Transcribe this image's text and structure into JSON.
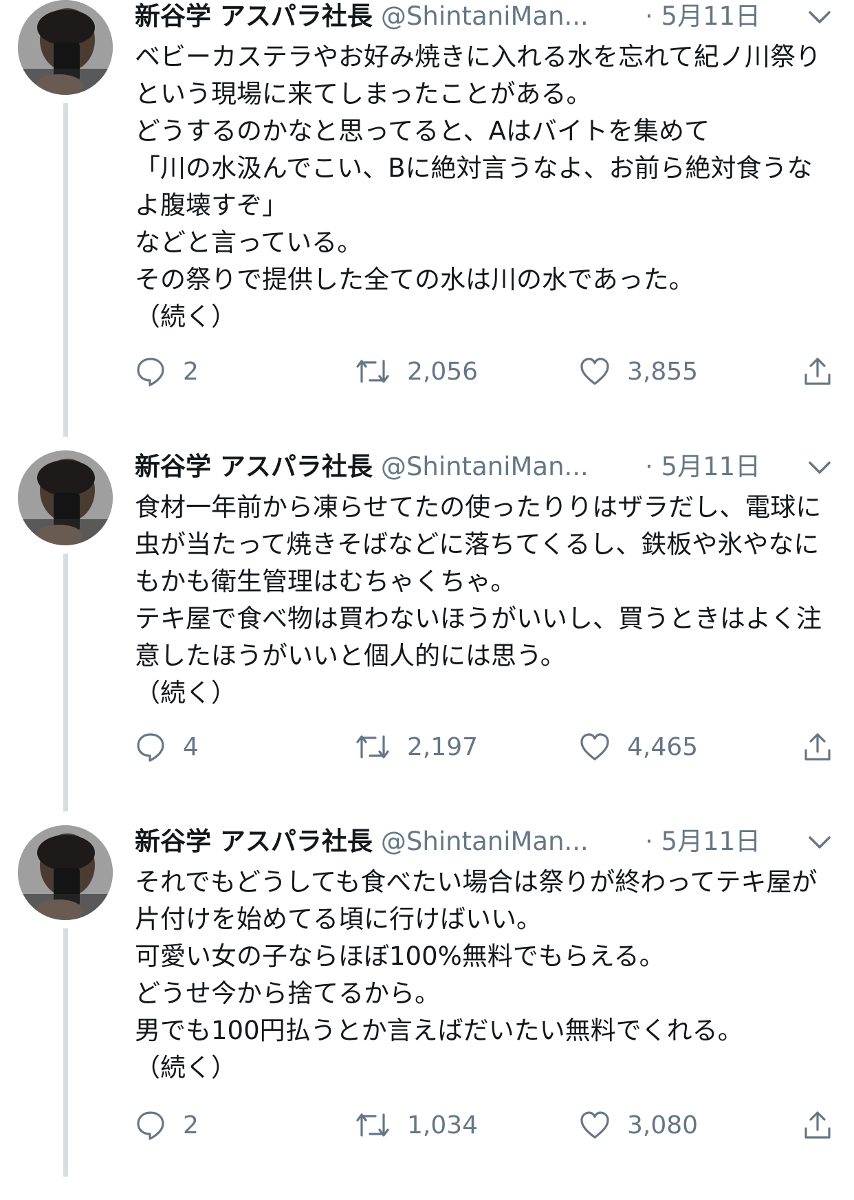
{
  "tweets": [
    {
      "name": "新谷学 アスパラ社長",
      "handle": "@ShintaniMan...",
      "date": "· 5月11日",
      "text": "ベビーカステラやお好み焼きに入れる水を忘れて紀ノ川祭りという現場に来てしまったことがある。\nどうするのかなと思ってると、Aはバイトを集めて\n「川の水汲んでこい、Bに絶対言うなよ、お前ら絶対食うなよ腹壊すぞ」\nなどと言っている。\nその祭りで提供した全ての水は川の水であった。\n（続く）",
      "replies": "2",
      "retweets": "2,056",
      "likes": "3,855"
    },
    {
      "name": "新谷学 アスパラ社長",
      "handle": "@ShintaniMan...",
      "date": "· 5月11日",
      "text": "食材一年前から凍らせてたの使ったりりはザラだし、電球に虫が当たって焼きそばなどに落ちてくるし、鉄板や氷やなにもかも衛生管理はむちゃくちゃ。\nテキ屋で食べ物は買わないほうがいいし、買うときはよく注意したほうがいいと個人的には思う。\n（続く）",
      "replies": "4",
      "retweets": "2,197",
      "likes": "4,465"
    },
    {
      "name": "新谷学 アスパラ社長",
      "handle": "@ShintaniMan...",
      "date": "· 5月11日",
      "text": "それでもどうしても食べたい場合は祭りが終わってテキ屋が片付けを始めてる頃に行けばいい。\n可愛い女の子ならほぼ100%無料でもらえる。\nどうせ今から捨てるから。\n男でも100円払うとか言えばだいたい無料でくれる。\n（続く）",
      "replies": "2",
      "retweets": "1,034",
      "likes": "3,080"
    }
  ],
  "colors": {
    "text": "#14171a",
    "secondary": "#657786",
    "thread_line": "#d8dde2"
  },
  "icons": {
    "reply": "reply-icon",
    "retweet": "retweet-icon",
    "like": "like-icon",
    "share": "share-icon",
    "caret": "chevron-down-icon"
  }
}
